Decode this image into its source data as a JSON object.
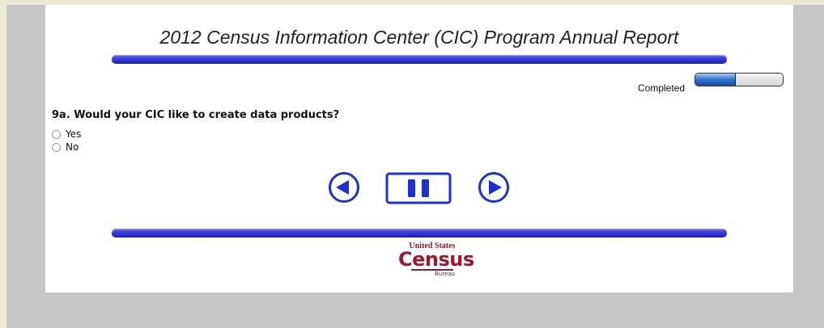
{
  "page": {
    "title": "2012 Census Information Center (CIC) Program Annual Report"
  },
  "progress": {
    "label": "Completed",
    "value_percent": 45
  },
  "question": {
    "text": "9a. Would your CIC like to create data products?",
    "options": [
      {
        "label": "Yes",
        "selected": false
      },
      {
        "label": "No",
        "selected": false
      }
    ]
  },
  "nav": {
    "prev_icon": "previous-arrow-icon",
    "pause_icon": "pause-icon",
    "next_icon": "next-arrow-icon"
  },
  "logo": {
    "line1": "United States",
    "line2": "Census",
    "line3": "Bureau"
  },
  "colors": {
    "bar": "#3a3ad9",
    "nav": "#1d2fd6",
    "logo": "#a1162e",
    "background": "#c6c6c6"
  }
}
